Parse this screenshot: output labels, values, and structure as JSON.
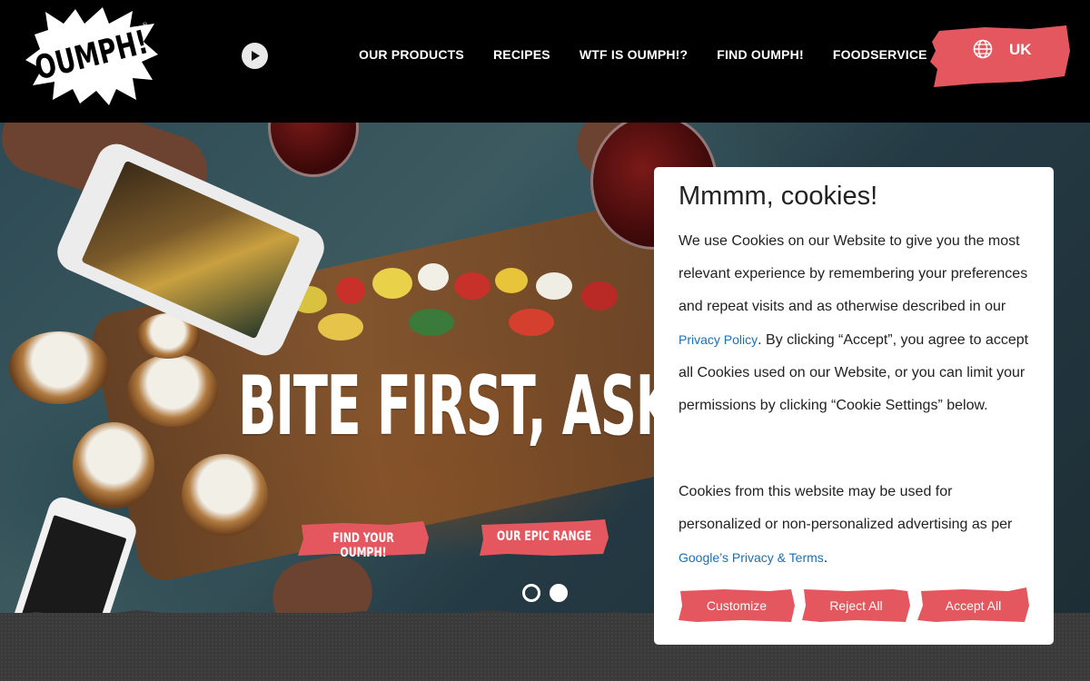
{
  "brand": {
    "logo_text": "OUMPH!",
    "accent": "#e4575f"
  },
  "nav": {
    "items": [
      {
        "label": "OUR PRODUCTS"
      },
      {
        "label": "RECIPES"
      },
      {
        "label": "WTF IS OUMPH!?"
      },
      {
        "label": "FIND OUMPH!"
      },
      {
        "label": "FOODSERVICE"
      }
    ]
  },
  "language": {
    "code": "UK",
    "icon": "globe-icon"
  },
  "hero": {
    "title": "BITE FIRST, ASK",
    "cta_primary": "FIND YOUR OUMPH!",
    "cta_secondary": "OUR EPIC RANGE",
    "slides": {
      "count": 2,
      "active": 2
    }
  },
  "cookie_dialog": {
    "title": "Mmmm, cookies!",
    "p1_before": "We use Cookies on our Website to give you the most relevant experience by remembering your preferences and repeat visits and as otherwise described in our ",
    "p1_link": "Privacy Policy",
    "p1_after": ". By clicking “Accept”, you agree to accept all Cookies used on our Website, or you can limit your permissions by clicking “Cookie Settings” below.",
    "p2_before": "Cookies from this website may be used for personalized or non-personalized advertising as per ",
    "p2_link": "Google’s Privacy & Terms",
    "p2_after": ".",
    "buttons": {
      "customize": "Customize",
      "reject": "Reject All",
      "accept": "Accept All"
    }
  }
}
